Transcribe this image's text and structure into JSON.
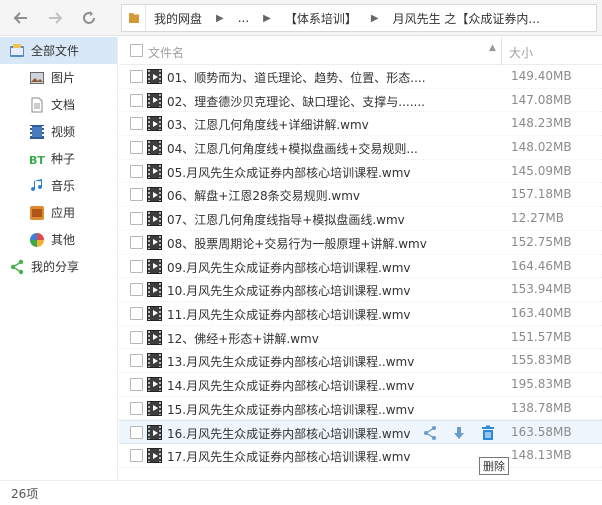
{
  "toolbar": {
    "back_icon": "back-arrow-icon",
    "forward_icon": "forward-arrow-icon",
    "refresh_icon": "refresh-icon"
  },
  "breadcrumb": {
    "items": [
      "我的网盘",
      "...",
      "【体系培训】",
      "月风先生 之【众成证券内..."
    ]
  },
  "sidebar": {
    "items": [
      {
        "label": "全部文件",
        "icon": "folder-icon",
        "active": true
      },
      {
        "label": "图片",
        "icon": "image-icon"
      },
      {
        "label": "文档",
        "icon": "document-icon"
      },
      {
        "label": "视频",
        "icon": "video-icon"
      },
      {
        "label": "种子",
        "icon": "bt-icon"
      },
      {
        "label": "音乐",
        "icon": "music-icon"
      },
      {
        "label": "应用",
        "icon": "app-icon"
      },
      {
        "label": "其他",
        "icon": "other-icon"
      },
      {
        "label": "我的分享",
        "icon": "share-icon"
      }
    ]
  },
  "list": {
    "header_name": "文件名",
    "header_size": "大小",
    "rows": [
      {
        "name": "01、顺势而为、道氏理论、趋势、位置、形态....",
        "size": "149.40MB"
      },
      {
        "name": "02、理查德沙贝克理论、缺口理论、支撑与.......",
        "size": "147.08MB"
      },
      {
        "name": "03、江恩几何角度线+详细讲解.wmv",
        "size": "148.23MB"
      },
      {
        "name": "04、江恩几何角度线+模拟盘画线+交易规则...",
        "size": "148.02MB"
      },
      {
        "name": "05.月风先生众成证券内部核心培训课程.wmv",
        "size": "145.09MB"
      },
      {
        "name": "06、解盘+江恩28条交易规则.wmv",
        "size": "157.18MB"
      },
      {
        "name": "07、江恩几何角度线指导+模拟盘画线.wmv",
        "size": "12.27MB"
      },
      {
        "name": "08、股票周期论+交易行为一般原理+讲解.wmv",
        "size": "152.75MB"
      },
      {
        "name": "09.月风先生众成证券内部核心培训课程.wmv",
        "size": "164.46MB"
      },
      {
        "name": "10.月风先生众成证券内部核心培训课程.wmv",
        "size": "153.94MB"
      },
      {
        "name": "11.月风先生众成证券内部核心培训课程.wmv",
        "size": "163.40MB"
      },
      {
        "name": "12、佛经+形态+讲解.wmv",
        "size": "151.57MB"
      },
      {
        "name": "13.月风先生众成证券内部核心培训课程..wmv",
        "size": "155.83MB"
      },
      {
        "name": "14.月风先生众成证券内部核心培训课程..wmv",
        "size": "195.83MB"
      },
      {
        "name": "15.月风先生众成证券内部核心培训课程..wmv",
        "size": "138.78MB"
      },
      {
        "name": "16.月风先生众成证券内部核心培训课程.wmv",
        "size": "163.58MB",
        "hover": true
      },
      {
        "name": "17.月风先生众成证券内部核心培训课程.wmv",
        "size": "148.13MB"
      }
    ]
  },
  "hover_actions": {
    "share_icon": "share-icon",
    "download_icon": "download-icon",
    "delete_icon": "trash-icon"
  },
  "tooltip": {
    "text": "删除"
  },
  "status": {
    "count": "26项"
  },
  "colors": {
    "accent": "#1a8ad8",
    "sidebar_active": "#d9e8f6",
    "row_hover": "#eef5fc"
  }
}
